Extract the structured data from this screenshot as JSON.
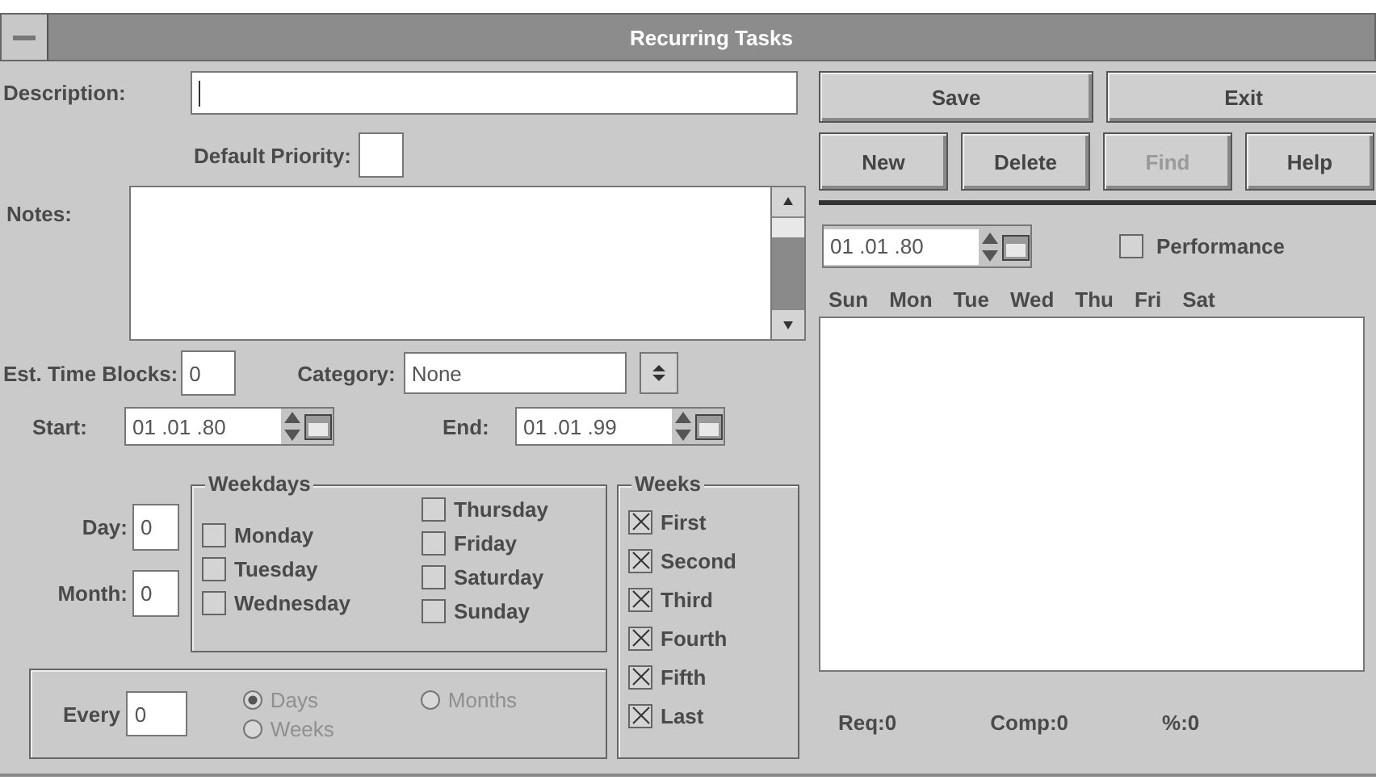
{
  "window": {
    "title": "Recurring Tasks"
  },
  "form": {
    "description": {
      "label": "Description:"
    },
    "default_priority": {
      "label": "Default Priority:"
    },
    "notes": {
      "label": "Notes:"
    },
    "est_time_blocks": {
      "label": "Est. Time Blocks:",
      "value": "0"
    },
    "category": {
      "label": "Category:",
      "value": "None"
    },
    "start": {
      "label": "Start:",
      "value": "01 .01 .80"
    },
    "end": {
      "label": "End:",
      "value": "01 .01 .99"
    },
    "day": {
      "label": "Day:",
      "value": "0"
    },
    "month": {
      "label": "Month:",
      "value": "0"
    },
    "weekdays": {
      "title": "Weekdays",
      "items": [
        {
          "label": "Monday",
          "checked": false
        },
        {
          "label": "Tuesday",
          "checked": false
        },
        {
          "label": "Wednesday",
          "checked": false
        },
        {
          "label": "Thursday",
          "checked": false
        },
        {
          "label": "Friday",
          "checked": false
        },
        {
          "label": "Saturday",
          "checked": false
        },
        {
          "label": "Sunday",
          "checked": false
        }
      ]
    },
    "weeks": {
      "title": "Weeks",
      "items": [
        {
          "label": "First",
          "checked": true
        },
        {
          "label": "Second",
          "checked": true
        },
        {
          "label": "Third",
          "checked": true
        },
        {
          "label": "Fourth",
          "checked": true
        },
        {
          "label": "Fifth",
          "checked": true
        },
        {
          "label": "Last",
          "checked": true
        }
      ]
    },
    "every": {
      "label": "Every",
      "value": "0",
      "options": [
        {
          "label": "Days",
          "selected": true,
          "disabled": true
        },
        {
          "label": "Months",
          "selected": false,
          "disabled": true
        },
        {
          "label": "Weeks",
          "selected": false,
          "disabled": true
        }
      ]
    }
  },
  "buttons": [
    {
      "label": "Save",
      "disabled": false
    },
    {
      "label": "Exit",
      "disabled": false
    },
    {
      "label": "New",
      "disabled": false
    },
    {
      "label": "Delete",
      "disabled": false
    },
    {
      "label": "Find",
      "disabled": true
    },
    {
      "label": "Help",
      "disabled": false
    }
  ],
  "calendar": {
    "date": "01 .01 .80",
    "performance": {
      "label": "Performance",
      "checked": false
    },
    "days": [
      "Sun",
      "Mon",
      "Tue",
      "Wed",
      "Thu",
      "Fri",
      "Sat"
    ],
    "stats": [
      "Req:0",
      "Comp:0",
      "%:0"
    ]
  }
}
